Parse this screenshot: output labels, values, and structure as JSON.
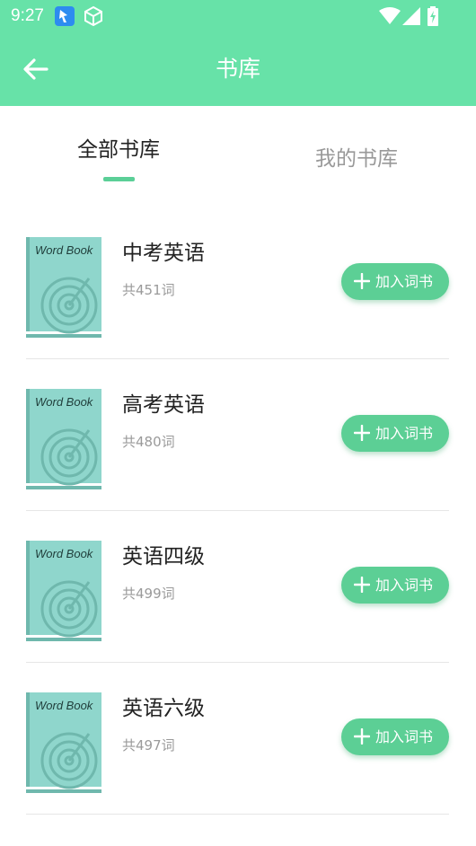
{
  "status_bar": {
    "time": "9:27",
    "icons": [
      "app-arrow-icon",
      "cube-icon",
      "wifi-icon",
      "cell-signal-icon",
      "battery-charging-icon"
    ]
  },
  "header": {
    "title": "书库",
    "back_icon": "arrow-left-icon"
  },
  "tabs": [
    {
      "label": "全部书库",
      "active": true
    },
    {
      "label": "我的书库",
      "active": false
    }
  ],
  "books": [
    {
      "cover_text": "Word Book",
      "name": "中考英语",
      "count": "共451词",
      "action_label": "加入词书"
    },
    {
      "cover_text": "Word Book",
      "name": "高考英语",
      "count": "共480词",
      "action_label": "加入词书"
    },
    {
      "cover_text": "Word Book",
      "name": "英语四级",
      "count": "共499词",
      "action_label": "加入词书"
    },
    {
      "cover_text": "Word Book",
      "name": "英语六级",
      "count": "共497词",
      "action_label": "加入词书"
    }
  ],
  "colors": {
    "header": "#67e2a8",
    "accent": "#5ccf95",
    "cover": "#8fd6cc",
    "cover_line": "#6fb8ad"
  }
}
